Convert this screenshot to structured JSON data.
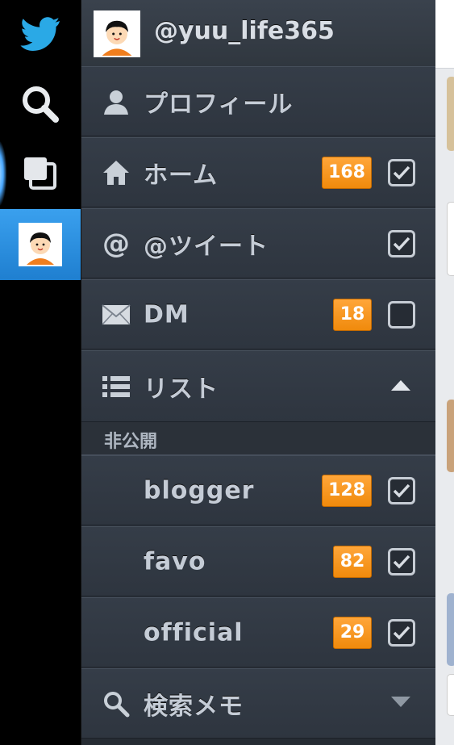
{
  "account": {
    "handle": "@yuu_life365"
  },
  "rail": {
    "items": [
      {
        "name": "twitter-bird-icon"
      },
      {
        "name": "search-icon"
      },
      {
        "name": "windows-icon"
      },
      {
        "name": "account-avatar"
      }
    ]
  },
  "menu": {
    "profile": {
      "label": "プロフィール"
    },
    "home": {
      "label": "ホーム",
      "badge": "168",
      "checked": true
    },
    "mentions": {
      "label": "@ツイート",
      "checked": true
    },
    "dm": {
      "label": "DM",
      "badge": "18",
      "checked": false
    },
    "lists": {
      "label": "リスト",
      "expanded": true
    },
    "private_section": {
      "label": "非公開"
    },
    "list_items": [
      {
        "label": "blogger",
        "badge": "128",
        "checked": true
      },
      {
        "label": "favo",
        "badge": "82",
        "checked": true
      },
      {
        "label": "official",
        "badge": "29",
        "checked": true
      }
    ],
    "search_memo": {
      "label": "検索メモ",
      "expanded": false
    }
  },
  "colors": {
    "badge": "#f7920f",
    "panel": "#2f3640",
    "active_rail": "#2c8be0",
    "twitter_blue": "#29a9e8"
  }
}
